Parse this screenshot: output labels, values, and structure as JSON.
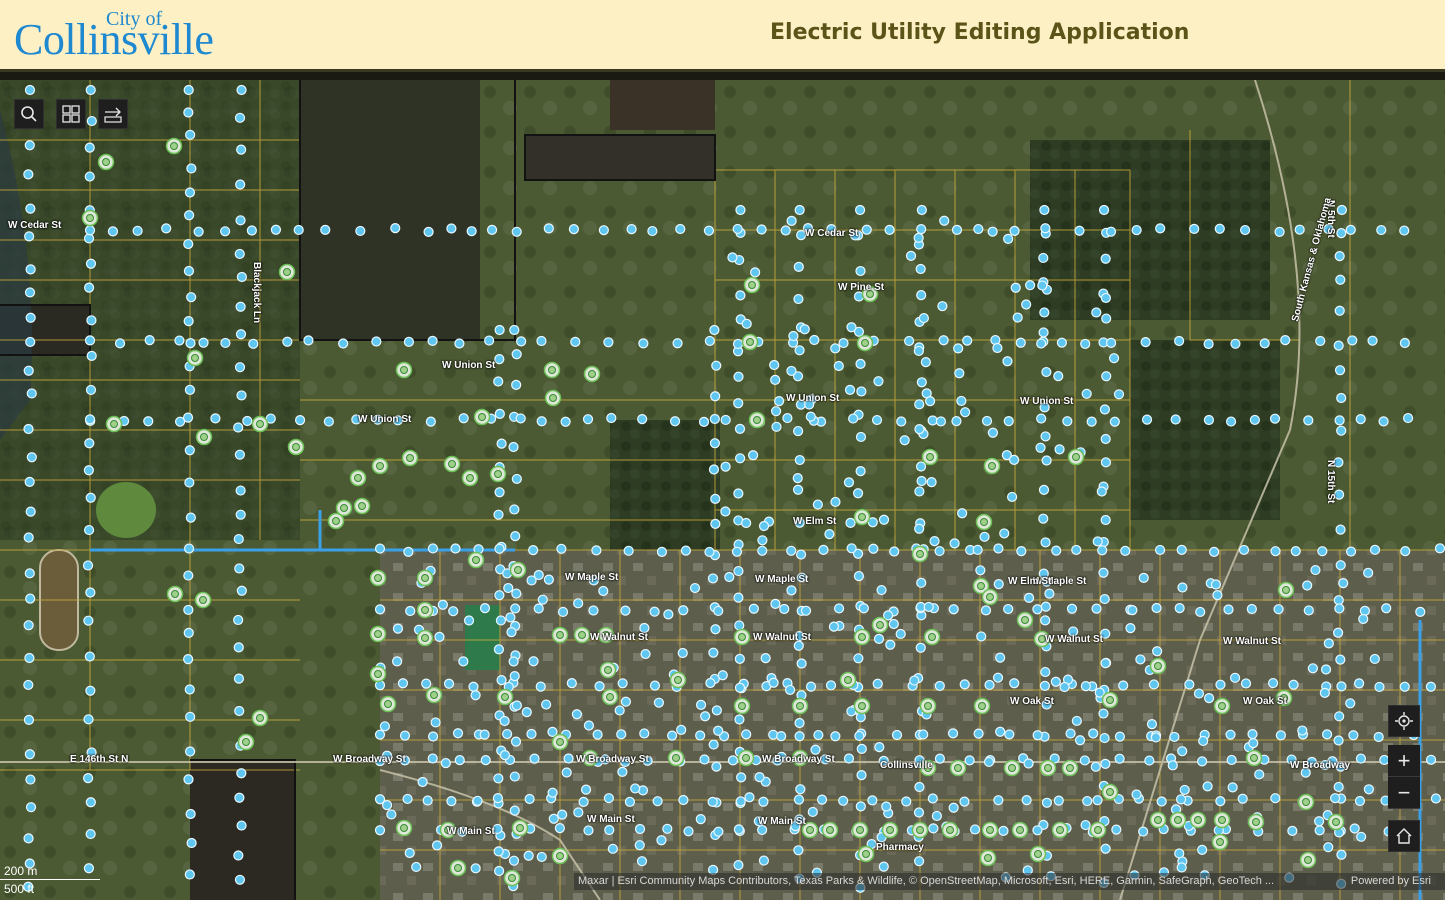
{
  "header": {
    "logo_small": "City of",
    "logo_big": "Collinsville",
    "title": "Electric Utility Editing Application",
    "brand_color": "#1e88d0",
    "title_color": "#5b5419"
  },
  "toolbar": {
    "search_icon": "search-icon",
    "basemap_icon": "basemap-gallery-icon",
    "measure_icon": "measure-icon"
  },
  "map_controls": {
    "locate_icon": "locate-icon",
    "zoom_in": "+",
    "zoom_out": "−",
    "home_icon": "home-icon"
  },
  "scalebar": {
    "metric": "200 m",
    "imperial": "500 ft"
  },
  "attribution": {
    "text": "Maxar | Esri Community Maps Contributors, Texas Parks & Wildlife, © OpenStreetMap, Microsoft, Esri, HERE, Garmin, SafeGraph, GeoTech ...",
    "powered": "Powered by Esri"
  },
  "street_labels": [
    "W Cedar St",
    "W Cedar St",
    "Blackjack Ln",
    "W Pine St",
    "W Union St",
    "W Union St",
    "W Union St",
    "W Union St",
    "W Elm St",
    "W Maple St",
    "W Maple St",
    "W Maple St",
    "W Walnut St",
    "W Walnut St",
    "W Walnut St",
    "W Walnut St",
    "W Oak St",
    "W Oak St",
    "E 146th St N",
    "W Broadway St",
    "W Broadway St",
    "W Broadway St",
    "W Broadway",
    "W Main St",
    "W Main St",
    "W Main St",
    "N 5th St",
    "N 15th St",
    "South Kansas & Oklahoma",
    "Collinsville",
    "Pharmacy",
    "W Elm St"
  ],
  "colors": {
    "pole": "#5fc6f0",
    "transformer": "#9fd08a",
    "parcel": "#c9a93a",
    "line": "#3aa0e8"
  }
}
